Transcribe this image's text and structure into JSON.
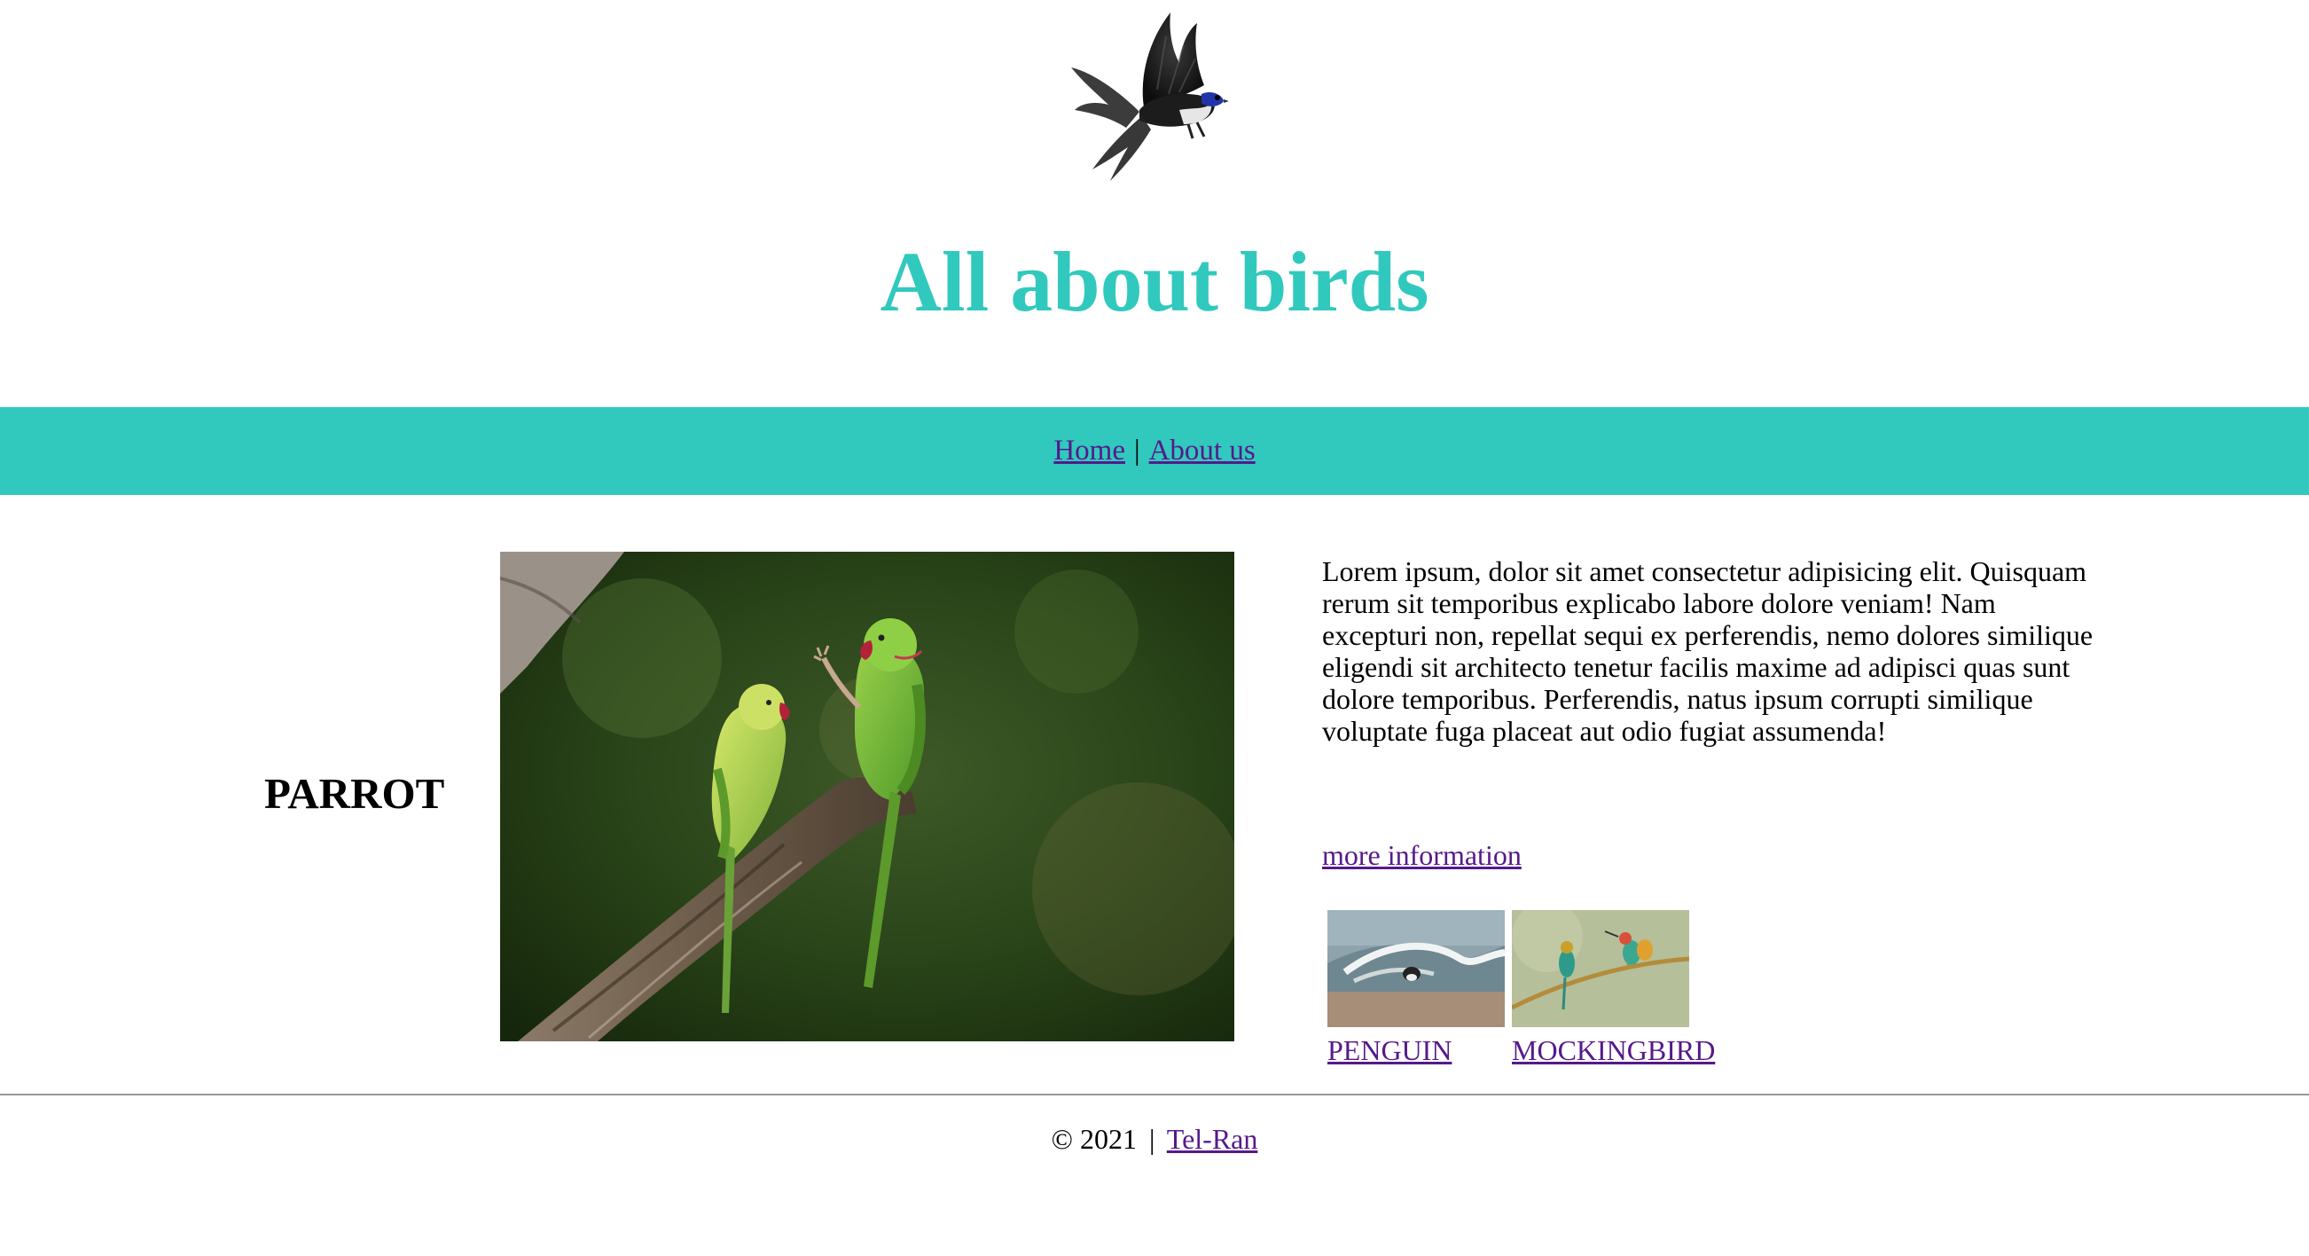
{
  "colors": {
    "accent": "#31c9bd",
    "link": "#551a8b",
    "text": "#000000",
    "footer_rule": "#999999"
  },
  "header": {
    "logo_icon": "flying-bird-icon",
    "title": "All about birds"
  },
  "nav": {
    "items": [
      {
        "label": "Home"
      },
      {
        "label": "About us"
      }
    ],
    "separator": "|"
  },
  "main": {
    "bird_name": "PARROT",
    "photo_subject": "parrot-photo",
    "description": "Lorem ipsum, dolor sit amet consectetur adipisicing elit. Quisquam rerum sit temporibus explicabo labore dolore veniam! Nam excepturi non, repellat sequi ex perferendis, nemo dolores similique eligendi sit architecto tenetur facilis maxime ad adipisci quas sunt dolore temporibus. Perferendis, natus ipsum corrupti similique voluptate fuga placeat aut odio fugiat assumenda!",
    "more_info_label": "more information",
    "related": [
      {
        "label": "PENGUIN"
      },
      {
        "label": "MOCKINGBIRD"
      }
    ]
  },
  "footer": {
    "copyright": "© 2021",
    "separator": "|",
    "link_label": "Tel-Ran"
  }
}
